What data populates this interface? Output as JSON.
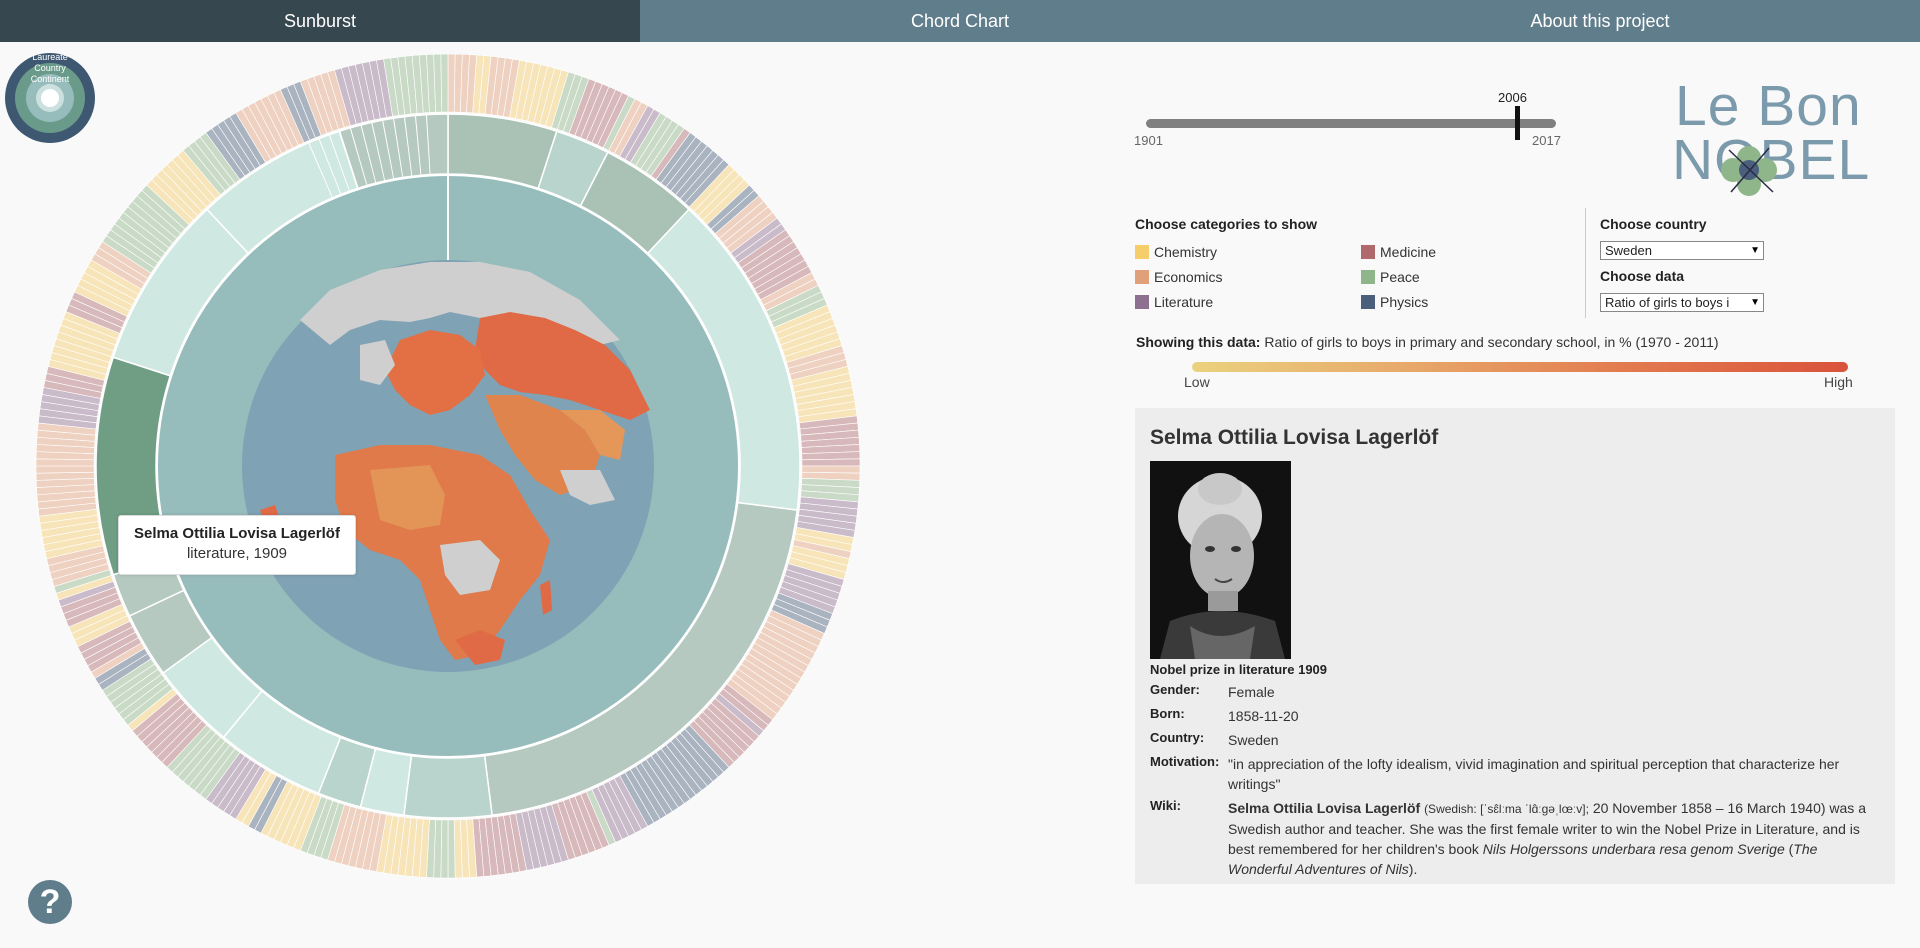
{
  "nav": {
    "tabs": [
      {
        "label": "Sunburst",
        "active": true
      },
      {
        "label": "Chord Chart",
        "active": false
      },
      {
        "label": "About this project",
        "active": false
      }
    ]
  },
  "legend_rings": [
    "Laureate",
    "Country",
    "Continent"
  ],
  "tooltip": {
    "name": "Selma Ottilia Lovisa Lagerlöf",
    "sub": "literature, 1909"
  },
  "help": {
    "label": "?"
  },
  "timeline": {
    "min": "1901",
    "max": "2017",
    "value": "2006",
    "value_fraction": 0.905
  },
  "brand": {
    "line1": "Le Bon",
    "line2": "NOBEL"
  },
  "categories": {
    "title": "Choose categories to show",
    "items": [
      {
        "label": "Chemistry",
        "color": "#f5cd6a"
      },
      {
        "label": "Medicine",
        "color": "#b06a6e"
      },
      {
        "label": "Economics",
        "color": "#e0a07a"
      },
      {
        "label": "Peace",
        "color": "#8fb58a"
      },
      {
        "label": "Literature",
        "color": "#8d6f8f"
      },
      {
        "label": "Physics",
        "color": "#4a5f7b"
      }
    ]
  },
  "country_select": {
    "title": "Choose country",
    "value": "Sweden"
  },
  "data_select": {
    "title": "Choose data",
    "value": "Ratio of girls to boys i"
  },
  "showing": {
    "label": "Showing this data:",
    "text": "Ratio of girls to boys in primary and secondary school, in % (1970 - 2011)",
    "low": "Low",
    "high": "High"
  },
  "laureate": {
    "name": "Selma Ottilia Lovisa Lagerlöf",
    "prize": "Nobel prize in literature 1909",
    "gender_k": "Gender:",
    "gender": "Female",
    "born_k": "Born:",
    "born": "1858-11-20",
    "country_k": "Country:",
    "country": "Sweden",
    "motivation_k": "Motivation:",
    "motivation": "\"in appreciation of the lofty idealism, vivid imagination and spiritual perception that characterize her writings\"",
    "wiki_k": "Wiki:",
    "wiki_name": "Selma Ottilia Lovisa Lagerlöf",
    "wiki_ipa": "(Swedish: [ˈsɛ̂lːma ˈlɑ̂ːɡəˌlœːv];",
    "wiki_text1": "20 November 1858 – 16 March 1940) was a Swedish author and teacher. She was the first female writer to win the Nobel Prize in Literature, and is best remembered for her children's book",
    "wiki_book": "Nils Holgerssons underbara resa genom Sverige",
    "wiki_paren_open": "(",
    "wiki_book_en": "The Wonderful Adventures of Nils",
    "wiki_end": ")."
  }
}
